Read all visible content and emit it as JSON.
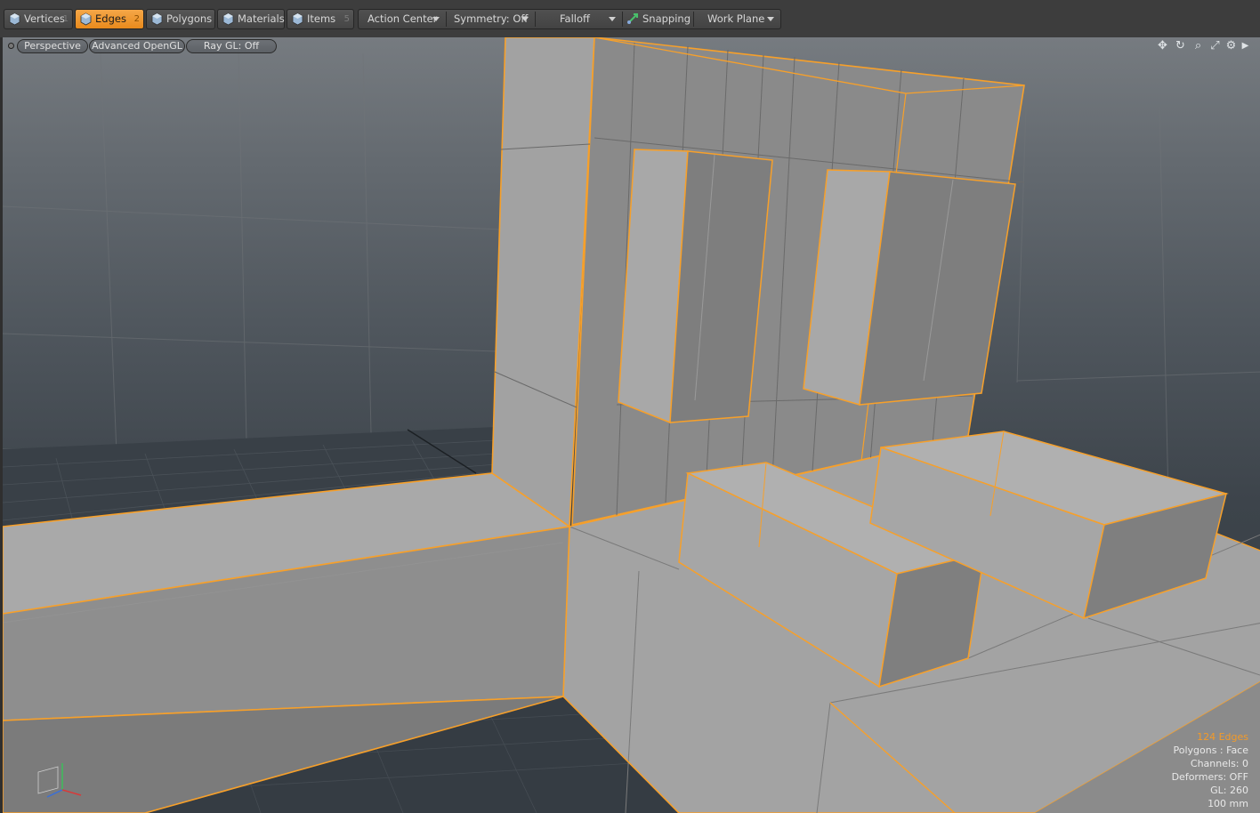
{
  "toolbar": {
    "modes": [
      {
        "label": "Vertices",
        "key": "1"
      },
      {
        "label": "Edges",
        "key": "2"
      },
      {
        "label": "Polygons",
        "key": ""
      },
      {
        "label": "Materials",
        "key": ""
      },
      {
        "label": "Items",
        "key": "5"
      }
    ],
    "action_center": "Action Center",
    "symmetry": "Symmetry: Off",
    "falloff": "Falloff",
    "snapping": "Snapping",
    "work_plane": "Work Plane"
  },
  "viewport": {
    "view": "Perspective",
    "shading": "Advanced OpenGL",
    "raygl": "Ray GL: Off"
  },
  "stats": {
    "edges": "124 Edges",
    "polygons": "Polygons : Face",
    "channels": "Channels: 0",
    "deformers": "Deformers: OFF",
    "gl": "GL: 260",
    "scale": "100 mm"
  },
  "colors": {
    "accent": "#f39a28",
    "selection_edge": "#f7a02a"
  },
  "icons": [
    "move-icon",
    "rotate-icon",
    "zoom-icon",
    "maximize-icon",
    "gear-icon",
    "arrow-right-icon"
  ]
}
